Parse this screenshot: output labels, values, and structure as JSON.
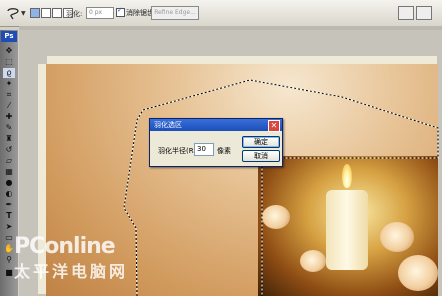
{
  "options_bar": {
    "feather_label": "羽化:",
    "feather_value": "0 px",
    "anti_alias_label": "消除锯齿",
    "anti_alias_checked": true,
    "refine_edge_label": "Refine Edge..."
  },
  "toolbox": {
    "logo": "Ps"
  },
  "dialog": {
    "title": "羽化选区",
    "radius_label": "羽化半径(R):",
    "radius_value": "30",
    "unit_label": "像素",
    "ok_label": "确定",
    "cancel_label": "取消"
  },
  "watermark": {
    "line1": "PConline",
    "line2": "太平洋电脑网"
  },
  "colors": {
    "dialog_title": "#1b4fb8",
    "close_button": "#d9473c",
    "toolbox_logo": "#1f4db6"
  }
}
